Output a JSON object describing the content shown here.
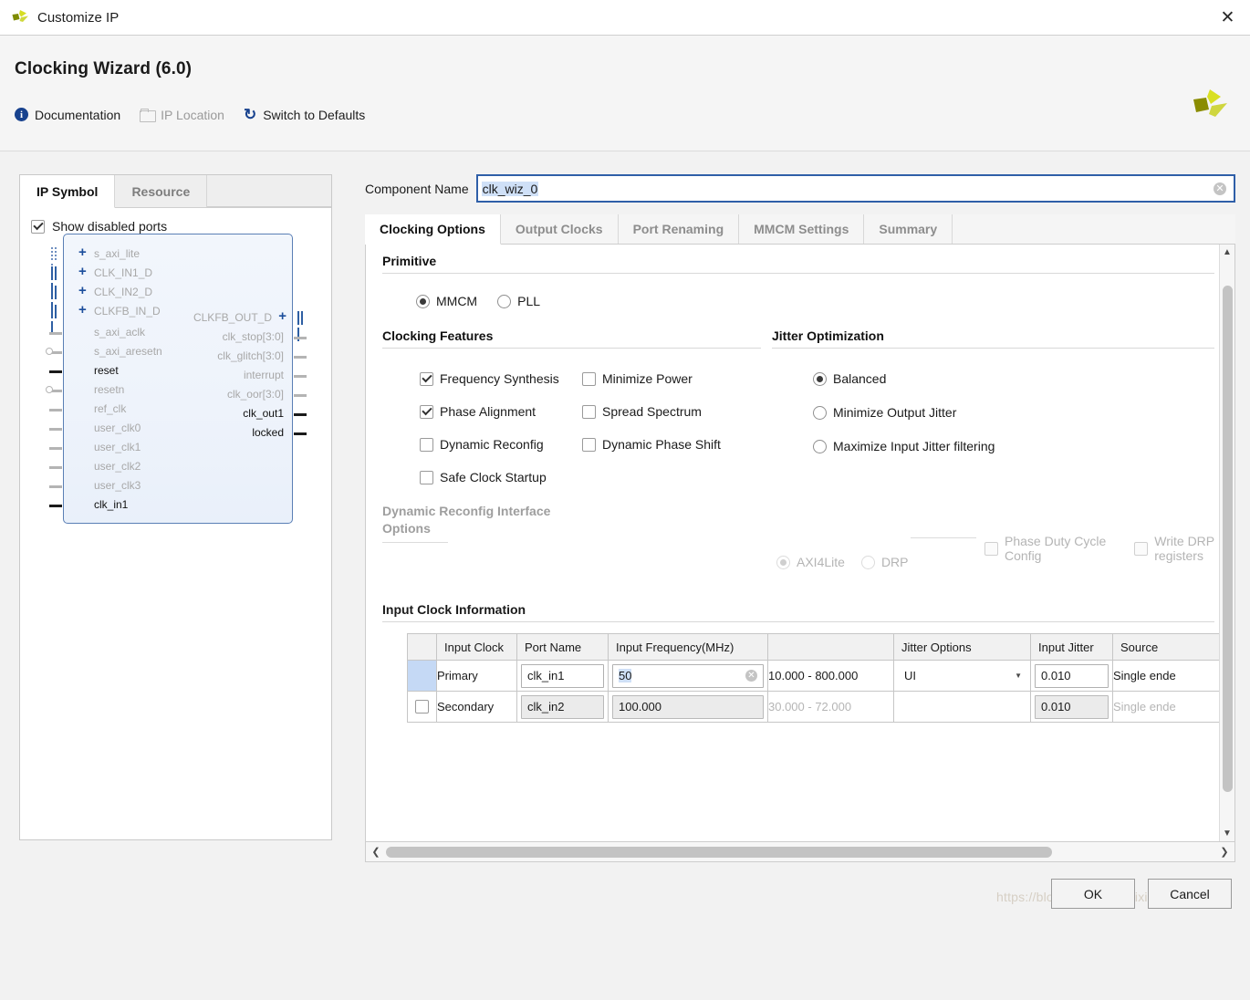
{
  "window": {
    "title": "Customize IP",
    "close_icon": "close-icon"
  },
  "header": {
    "title": "Clocking Wizard (6.0)",
    "links": [
      {
        "label": "Documentation",
        "icon": "info-icon",
        "enabled": true
      },
      {
        "label": "IP Location",
        "icon": "folder-icon",
        "enabled": false
      },
      {
        "label": "Switch to Defaults",
        "icon": "refresh-icon",
        "enabled": true
      }
    ],
    "logo": "xilinx-logo"
  },
  "left_panel": {
    "tabs": [
      {
        "label": "IP Symbol",
        "active": true
      },
      {
        "label": "Resource",
        "active": false
      }
    ],
    "show_disabled_ports": {
      "label": "Show disabled ports",
      "checked": true
    },
    "symbol": {
      "bus_inputs": [
        {
          "label": "s_axi_lite",
          "enabled": false
        },
        {
          "label": "CLK_IN1_D",
          "enabled": false
        },
        {
          "label": "CLK_IN2_D",
          "enabled": false
        },
        {
          "label": "CLKFB_IN_D",
          "enabled": false
        }
      ],
      "inputs": [
        {
          "label": "s_axi_aclk",
          "enabled": false,
          "inverted": false
        },
        {
          "label": "s_axi_aresetn",
          "enabled": false,
          "inverted": true
        },
        {
          "label": "reset",
          "enabled": true,
          "inverted": false
        },
        {
          "label": "resetn",
          "enabled": false,
          "inverted": true
        },
        {
          "label": "ref_clk",
          "enabled": false,
          "inverted": false
        },
        {
          "label": "user_clk0",
          "enabled": false,
          "inverted": false
        },
        {
          "label": "user_clk1",
          "enabled": false,
          "inverted": false
        },
        {
          "label": "user_clk2",
          "enabled": false,
          "inverted": false
        },
        {
          "label": "user_clk3",
          "enabled": false,
          "inverted": false
        },
        {
          "label": "clk_in1",
          "enabled": true,
          "inverted": false
        }
      ],
      "bus_outputs": [
        {
          "label": "CLKFB_OUT_D",
          "enabled": false
        }
      ],
      "outputs": [
        {
          "label": "clk_stop[3:0]",
          "enabled": false
        },
        {
          "label": "clk_glitch[3:0]",
          "enabled": false
        },
        {
          "label": "interrupt",
          "enabled": false
        },
        {
          "label": "clk_oor[3:0]",
          "enabled": false
        },
        {
          "label": "clk_out1",
          "enabled": true
        },
        {
          "label": "locked",
          "enabled": true
        }
      ]
    }
  },
  "component_name": {
    "label": "Component Name",
    "value": "clk_wiz_0",
    "clear_icon": "clear-icon"
  },
  "tabs": [
    {
      "label": "Clocking Options",
      "active": true
    },
    {
      "label": "Output Clocks",
      "active": false
    },
    {
      "label": "Port Renaming",
      "active": false
    },
    {
      "label": "MMCM Settings",
      "active": false
    },
    {
      "label": "Summary",
      "active": false
    }
  ],
  "primitive": {
    "title": "Primitive",
    "options": [
      {
        "label": "MMCM",
        "selected": true
      },
      {
        "label": "PLL",
        "selected": false
      }
    ]
  },
  "clocking_features": {
    "title": "Clocking Features",
    "items": [
      {
        "label": "Frequency Synthesis",
        "checked": true
      },
      {
        "label": "Minimize Power",
        "checked": false
      },
      {
        "label": "Phase Alignment",
        "checked": true
      },
      {
        "label": "Spread Spectrum",
        "checked": false
      },
      {
        "label": "Dynamic Reconfig",
        "checked": false
      },
      {
        "label": "Dynamic Phase Shift",
        "checked": false
      },
      {
        "label": "Safe Clock Startup",
        "checked": false
      }
    ]
  },
  "jitter_optimization": {
    "title": "Jitter Optimization",
    "options": [
      {
        "label": "Balanced",
        "selected": true
      },
      {
        "label": "Minimize Output Jitter",
        "selected": false
      },
      {
        "label": "Maximize Input Jitter filtering",
        "selected": false
      }
    ]
  },
  "dynamic_reconfig": {
    "title_line1": "Dynamic Reconfig Interface",
    "title_line2": "Options",
    "radios": [
      {
        "label": "AXI4Lite",
        "selected": true,
        "enabled": false
      },
      {
        "label": "DRP",
        "selected": false,
        "enabled": false
      }
    ],
    "checks": [
      {
        "label": "Phase Duty Cycle Config",
        "checked": false,
        "enabled": false
      },
      {
        "label": "Write DRP registers",
        "checked": false,
        "enabled": false
      }
    ]
  },
  "input_clock_information": {
    "title": "Input Clock Information",
    "columns": [
      "",
      "Input Clock",
      "Port Name",
      "Input Frequency(MHz)",
      "",
      "Jitter Options",
      "Input Jitter",
      "Source"
    ],
    "rows": [
      {
        "selected": true,
        "has_checkbox": false,
        "input_clock": "Primary",
        "port_name": "clk_in1",
        "input_frequency": "50",
        "range": "10.000 - 800.000",
        "jitter_options": "UI",
        "input_jitter": "0.010",
        "source": "Single ende",
        "enabled": true
      },
      {
        "selected": false,
        "has_checkbox": true,
        "checked": false,
        "input_clock": "Secondary",
        "port_name": "clk_in2",
        "input_frequency": "100.000",
        "range": "30.000 - 72.000",
        "jitter_options": "",
        "input_jitter": "0.010",
        "source": "Single ende",
        "enabled": false
      }
    ]
  },
  "footer": {
    "ok_label": "OK",
    "cancel_label": "Cancel"
  },
  "watermark": "https://blog.csdn.net/weixin_42470069"
}
